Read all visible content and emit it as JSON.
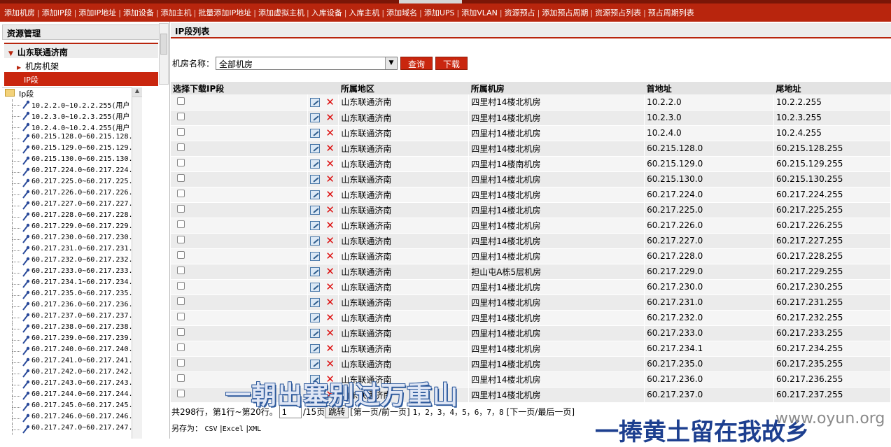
{
  "topnav": {
    "items": [
      "添加机房",
      "添加IP段",
      "添加IP地址",
      "添加设备",
      "添加主机",
      "批量添加IP地址",
      "添加虚拟主机",
      "入库设备",
      "入库主机",
      "添加域名",
      "添加UPS",
      "添加VLAN",
      "资源预占",
      "添加预占周期",
      "资源预占列表",
      "预占周期列表"
    ]
  },
  "left": {
    "title": "资源管理",
    "region": "山东联通济南",
    "rack": "机房机架",
    "ipseg": "IP段",
    "tree_root": "Ip段",
    "tree_items": [
      "10.2.2.0~10.2.2.255(用户",
      "10.2.3.0~10.2.3.255(用户",
      "10.2.4.0~10.2.4.255(用户",
      "60.215.128.0~60.215.128.",
      "60.215.129.0~60.215.129.",
      "60.215.130.0~60.215.130.",
      "60.217.224.0~60.217.224.",
      "60.217.225.0~60.217.225.",
      "60.217.226.0~60.217.226.",
      "60.217.227.0~60.217.227.",
      "60.217.228.0~60.217.228.",
      "60.217.229.0~60.217.229.",
      "60.217.230.0~60.217.230.",
      "60.217.231.0~60.217.231.",
      "60.217.232.0~60.217.232.",
      "60.217.233.0~60.217.233.",
      "60.217.234.1~60.217.234.",
      "60.217.235.0~60.217.235.",
      "60.217.236.0~60.217.236.",
      "60.217.237.0~60.217.237.",
      "60.217.238.0~60.217.238.",
      "60.217.239.0~60.217.239.",
      "60.217.240.0~60.217.240.",
      "60.217.241.0~60.217.241.",
      "60.217.242.0~60.217.242.",
      "60.217.243.0~60.217.243.",
      "60.217.244.0~60.217.244.",
      "60.217.245.0~60.217.245.",
      "60.217.246.0~60.217.246.",
      "60.217.247.0~60.217.247."
    ]
  },
  "main": {
    "header": "IP段列表",
    "filter_label": "机房名称：",
    "filter_value": "全部机房",
    "query_btn": "查询",
    "download_btn": "下载",
    "columns": [
      "选择下载IP段",
      "",
      "所属地区",
      "所属机房",
      "首地址",
      "尾地址"
    ],
    "rows": [
      [
        "山东联通济南",
        "四里村14楼北机房",
        "10.2.2.0",
        "10.2.2.255"
      ],
      [
        "山东联通济南",
        "四里村14楼北机房",
        "10.2.3.0",
        "10.2.3.255"
      ],
      [
        "山东联通济南",
        "四里村14楼北机房",
        "10.2.4.0",
        "10.2.4.255"
      ],
      [
        "山东联通济南",
        "四里村14楼北机房",
        "60.215.128.0",
        "60.215.128.255"
      ],
      [
        "山东联通济南",
        "四里村14楼南机房",
        "60.215.129.0",
        "60.215.129.255"
      ],
      [
        "山东联通济南",
        "四里村14楼北机房",
        "60.215.130.0",
        "60.215.130.255"
      ],
      [
        "山东联通济南",
        "四里村14楼北机房",
        "60.217.224.0",
        "60.217.224.255"
      ],
      [
        "山东联通济南",
        "四里村14楼北机房",
        "60.217.225.0",
        "60.217.225.255"
      ],
      [
        "山东联通济南",
        "四里村14楼北机房",
        "60.217.226.0",
        "60.217.226.255"
      ],
      [
        "山东联通济南",
        "四里村14楼北机房",
        "60.217.227.0",
        "60.217.227.255"
      ],
      [
        "山东联通济南",
        "四里村14楼北机房",
        "60.217.228.0",
        "60.217.228.255"
      ],
      [
        "山东联通济南",
        "担山屯A栋5层机房",
        "60.217.229.0",
        "60.217.229.255"
      ],
      [
        "山东联通济南",
        "四里村14楼北机房",
        "60.217.230.0",
        "60.217.230.255"
      ],
      [
        "山东联通济南",
        "四里村14楼北机房",
        "60.217.231.0",
        "60.217.231.255"
      ],
      [
        "山东联通济南",
        "四里村14楼北机房",
        "60.217.232.0",
        "60.217.232.255"
      ],
      [
        "山东联通济南",
        "四里村14楼北机房",
        "60.217.233.0",
        "60.217.233.255"
      ],
      [
        "山东联通济南",
        "四里村14楼北机房",
        "60.217.234.1",
        "60.217.234.255"
      ],
      [
        "山东联通济南",
        "四里村14楼北机房",
        "60.217.235.0",
        "60.217.235.255"
      ],
      [
        "山东联通济南",
        "四里村14楼北机房",
        "60.217.236.0",
        "60.217.236.255"
      ],
      [
        "山东联通济南",
        "四里村14楼北机房",
        "60.217.237.0",
        "60.217.237.255"
      ]
    ]
  },
  "pager": {
    "summary": "共298行，第1行~第20行。",
    "page_value": "1",
    "total_pages": "/15页",
    "go_btn": "跳转",
    "first_prev": "[第一页/前一页]",
    "pages": "1，2，3，4，5，6，7，8",
    "next_last": "[下一页/最后一页]"
  },
  "export": {
    "label": "另存为：",
    "csv": "CSV",
    "excel": "Excel",
    "xml": "XML"
  },
  "overlay": {
    "subtitle1": "一朝出塞别过万重山",
    "subtitle2": "一捧黄土留在我故乡",
    "watermark": "www.oyun.org"
  },
  "colors": {
    "brand_red": "#b8250d",
    "delete_red": "#dd1111"
  },
  "icons": {
    "edit": "edit-icon",
    "delete": "delete-icon",
    "folder": "folder-icon",
    "tree_node": "node-icon"
  }
}
